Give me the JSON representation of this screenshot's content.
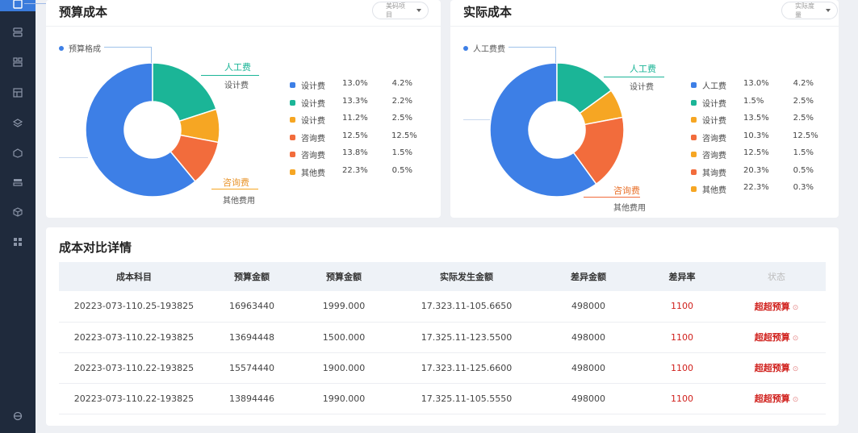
{
  "sidebar": {
    "icons": [
      "home-icon",
      "server-icon",
      "dashboard-icon",
      "table-icon",
      "layers-icon",
      "box-icon",
      "storage-icon",
      "cube-icon",
      "grid-icon",
      "settings-icon"
    ]
  },
  "budget": {
    "title": "预算成本",
    "dropdown": "美码项目",
    "series_label": "预算格成",
    "callouts": [
      {
        "label": "人工费",
        "sub": "设计费"
      },
      {
        "label": "咨询费",
        "sub": "其他费用"
      }
    ],
    "legend": [
      {
        "name": "设计费",
        "pct": "13.0%",
        "val": "4.2%",
        "color": "#3d7fe6"
      },
      {
        "name": "设计费",
        "pct": "13.3%",
        "val": "2.2%",
        "color": "#1bb597"
      },
      {
        "name": "设计费",
        "pct": "11.2%",
        "val": "2.5%",
        "color": "#f6a623"
      },
      {
        "name": "咨询费",
        "pct": "12.5%",
        "val": "12.5%",
        "color": "#f26c3c"
      },
      {
        "name": "咨询费",
        "pct": "13.8%",
        "val": "1.5%",
        "color": "#f26c3c"
      },
      {
        "name": "其他费",
        "pct": "22.3%",
        "val": "0.5%",
        "color": "#f6a623"
      }
    ],
    "pie": [
      {
        "value": 61,
        "color": "#3d7fe6"
      },
      {
        "value": 20,
        "color": "#1bb597"
      },
      {
        "value": 8,
        "color": "#f6a623"
      },
      {
        "value": 11,
        "color": "#f26c3c"
      }
    ]
  },
  "actual": {
    "title": "实际成本",
    "dropdown": "实际度量",
    "series_label": "人工费费",
    "callouts": [
      {
        "label": "人工费",
        "sub": "设计费"
      },
      {
        "label": "咨询费",
        "sub": "其他费用"
      }
    ],
    "legend": [
      {
        "name": "人工费",
        "pct": "13.0%",
        "val": "4.2%",
        "color": "#3d7fe6"
      },
      {
        "name": "设计费",
        "pct": "1.5%",
        "val": "2.5%",
        "color": "#1bb597"
      },
      {
        "name": "设计费",
        "pct": "13.5%",
        "val": "2.5%",
        "color": "#f6a623"
      },
      {
        "name": "咨询费",
        "pct": "10.3%",
        "val": "12.5%",
        "color": "#f26c3c"
      },
      {
        "name": "咨询费",
        "pct": "12.5%",
        "val": "1.5%",
        "color": "#f6a623"
      },
      {
        "name": "其询费",
        "pct": "20.3%",
        "val": "0.5%",
        "color": "#f26c3c"
      },
      {
        "name": "其他费",
        "pct": "22.3%",
        "val": "0.3%",
        "color": "#f6a623"
      }
    ],
    "pie": [
      {
        "value": 60,
        "color": "#3d7fe6"
      },
      {
        "value": 15,
        "color": "#1bb597"
      },
      {
        "value": 7,
        "color": "#f6a623"
      },
      {
        "value": 18,
        "color": "#f26c3c"
      }
    ]
  },
  "details": {
    "title": "成本对比详情",
    "columns": [
      "成本科目",
      "预算金额",
      "预算金额",
      "实际发生金额",
      "差异金额",
      "差异率",
      "状态"
    ],
    "rows": [
      [
        "20223-073-110.25-193825",
        "16963440",
        "1999.000",
        "17.323.11-105.6650",
        "498000",
        "1100",
        "超超预算"
      ],
      [
        "20223-073-110.22-193825",
        "13694448",
        "1500.000",
        "17.325.11-123.5500",
        "498000",
        "1100",
        "超超预算"
      ],
      [
        "20223-073-110.22-193825",
        "15574440",
        "1900.000",
        "17.323.11-125.6600",
        "498000",
        "1100",
        "超超预算"
      ],
      [
        "20223-073-110.22-193825",
        "13894446",
        "1990.000",
        "17.325.11-105.5550",
        "498000",
        "1100",
        "超超预算"
      ]
    ]
  }
}
